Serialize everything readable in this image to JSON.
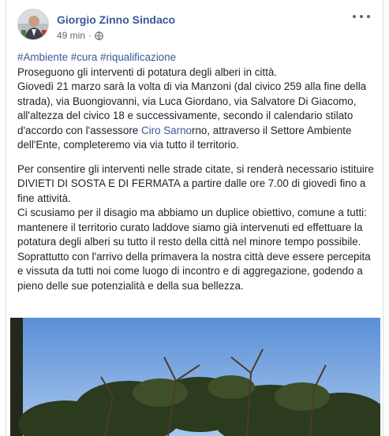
{
  "post": {
    "author": "Giorgio Zinno Sindaco",
    "time": "49 min",
    "separator": "·",
    "privacy_icon": "globe-icon",
    "more_icon": "more-horizontal-icon",
    "hashtags": [
      "#Ambiente",
      "#cura",
      "#riqualificazione"
    ],
    "paragraph1": {
      "line1": "Proseguono gli interventi di potatura degli alberi in città.",
      "before_mention": "Giovedì 21 marzo sarà la volta di via Manzoni (dal civico 259 alla fine della strada), via Buongiovanni, via Luca Giordano, via Salvatore Di Giacomo, all'altezza del civico 18 e successivamente, secondo il calendario stilato d'accordo con l'assessore ",
      "mention": "Ciro Sarno",
      "after_mention": "rno, attraverso il Settore Ambiente dell'Ente, completeremo via via tutto il territorio."
    },
    "paragraph2": {
      "line1": "Per consentire gli interventi nelle strade citate, si renderà necessario istituire DIVIETI DI SOSTA E DI FERMATA a partire dalle ore 7.00 di giovedì fino a fine attività.",
      "line2": "Ci scusiamo per il disagio ma abbiamo un duplice obiettivo, comune a tutti: mantenere il territorio curato laddove siamo già intervenuti ed effettuare la potatura degli alberi su tutto il resto della città nel minore tempo possibile.",
      "line3": "Soprattutto con l'arrivo della primavera la nostra città deve essere percepita e vissuta da tutti noi come luogo di incontro e di aggregazione, godendo a pieno delle sue potenzialità e della sua bellezza."
    },
    "photo": {
      "sky_color": "#6f9fdd",
      "tree_color": "#2f3a1f"
    }
  },
  "colors": {
    "link": "#385898",
    "text": "#1d2129",
    "meta": "#616770"
  }
}
